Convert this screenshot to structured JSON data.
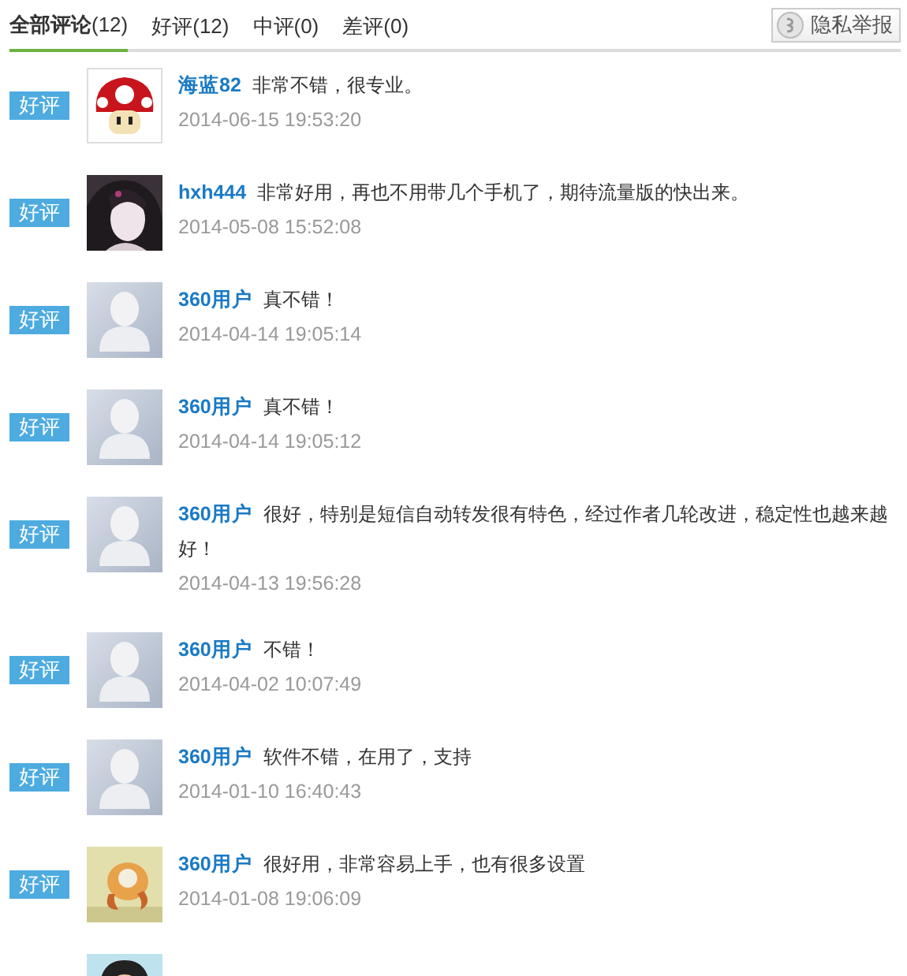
{
  "tabs": [
    {
      "label": "全部评论",
      "count": "(12)",
      "selected": true
    },
    {
      "label": "好评",
      "count": "(12)",
      "selected": false
    },
    {
      "label": "中评",
      "count": "(0)",
      "selected": false
    },
    {
      "label": "差评",
      "count": "(0)",
      "selected": false
    }
  ],
  "report_button": {
    "label": "隐私举报"
  },
  "reviews": [
    {
      "rating": "好评",
      "avatar": {
        "kind": "mushroom"
      },
      "user": "海蓝82",
      "comment": "非常不错，很专业。",
      "date": "2014-06-15 19:53:20"
    },
    {
      "rating": "好评",
      "user": "hxh444",
      "comment": "非常好用，再也不用带几个手机了，期待流量版的快出来。",
      "date": "2014-05-08 15:52:08"
    },
    {
      "rating": "好评",
      "avatar": {
        "kind": "default"
      },
      "user": "360用户",
      "comment": "真不错！",
      "date": "2014-04-14 19:05:14"
    },
    {
      "rating": "好评",
      "avatar": {
        "kind": "default"
      },
      "user": "360用户",
      "comment": "真不错！",
      "date": "2014-04-14 19:05:12"
    },
    {
      "rating": "好评",
      "avatar": {
        "kind": "default"
      },
      "user": "360用户",
      "comment": "很好，特别是短信自动转发很有特色，经过作者几轮改进，稳定性也越来越好！",
      "date": "2014-04-13 19:56:28"
    },
    {
      "rating": "好评",
      "avatar": {
        "kind": "default"
      },
      "user": "360用户",
      "comment": "不错！",
      "date": "2014-04-02 10:07:49"
    },
    {
      "rating": "好评",
      "avatar": {
        "kind": "default"
      },
      "user": "360用户",
      "comment": "软件不错，在用了，支持",
      "date": "2014-01-10 16:40:43"
    },
    {
      "rating": "好评",
      "user": "360用户",
      "comment": "很好用，非常容易上手，也有很多设置",
      "date": "2014-01-08 19:06:09"
    },
    {
      "avatar": {
        "kind": "cartoon"
      }
    }
  ]
}
